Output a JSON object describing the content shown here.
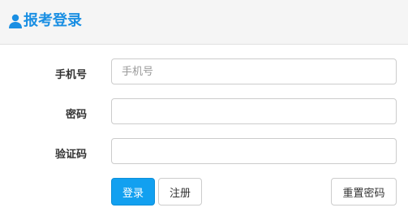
{
  "header": {
    "title": "报考登录",
    "icon": "user-icon",
    "accent_color": "#1a8fe3"
  },
  "form": {
    "phone": {
      "label": "手机号",
      "placeholder": "手机号",
      "value": ""
    },
    "password": {
      "label": "密码",
      "placeholder": "",
      "value": ""
    },
    "captcha": {
      "label": "验证码",
      "placeholder": "",
      "value": ""
    }
  },
  "actions": {
    "login_label": "登录",
    "register_label": "注册",
    "reset_password_label": "重置密码",
    "primary_color": "#12a0f0"
  }
}
